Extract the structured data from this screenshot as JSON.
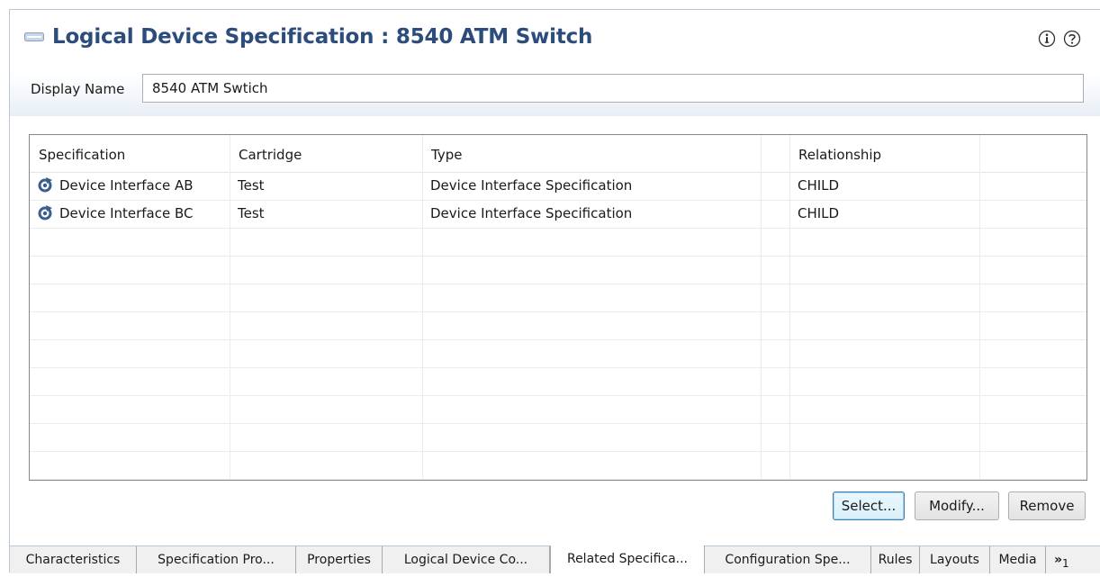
{
  "header": {
    "title": "Logical Device Specification : 8540 ATM Switch",
    "info_icon": "info-circle-icon",
    "help_icon": "question-circle-icon"
  },
  "display_name": {
    "label": "Display Name",
    "value": "8540 ATM Swtich"
  },
  "table": {
    "columns": [
      "Specification",
      "Cartridge",
      "Type",
      "",
      "Relationship",
      ""
    ],
    "rows": [
      {
        "icon": "device-interface-icon",
        "specification": "Device Interface AB",
        "cartridge": "Test",
        "type": "Device Interface Specification",
        "relationship": "CHILD"
      },
      {
        "icon": "device-interface-icon",
        "specification": "Device Interface BC",
        "cartridge": "Test",
        "type": "Device Interface Specification",
        "relationship": "CHILD"
      }
    ]
  },
  "buttons": {
    "select": "Select...",
    "modify": "Modify...",
    "remove": "Remove"
  },
  "tabs": [
    "Characteristics",
    "Specification Pro...",
    "Properties",
    "Logical Device Co...",
    "Related Specifica...",
    "Configuration Spe...",
    "Rules",
    "Layouts",
    "Media"
  ],
  "active_tab": "Related Specifica...",
  "tabs_overflow": {
    "glyph": "»",
    "count": "1"
  },
  "colors": {
    "title": "#2c4c7c",
    "accent_border": "#3c7fb1"
  }
}
